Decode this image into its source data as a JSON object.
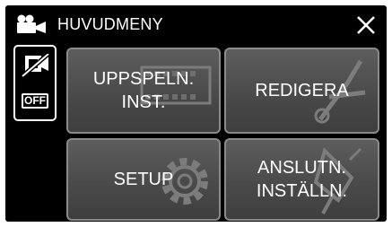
{
  "header": {
    "title": "HUVUDMENY",
    "icon": "video-camera-icon",
    "close_icon": "close-x-icon"
  },
  "side_button": {
    "icon": "camera-off-icon",
    "badge": "OFF"
  },
  "tiles": [
    {
      "label": "UPPSPELN.\nINST.",
      "icon": "film-strip-icon"
    },
    {
      "label": "REDIGERA",
      "icon": "scissors-icon"
    },
    {
      "label": "SETUP",
      "icon": "gear-icon"
    },
    {
      "label": "ANSLUTN.\nINSTÄLLN.",
      "icon": "plug-icon"
    }
  ],
  "colors": {
    "background": "#000000",
    "tile_top": "#5d5d5d",
    "tile_bottom": "#3e3e3e",
    "text": "#ffffff",
    "tile_border": "#8a8a8a"
  }
}
